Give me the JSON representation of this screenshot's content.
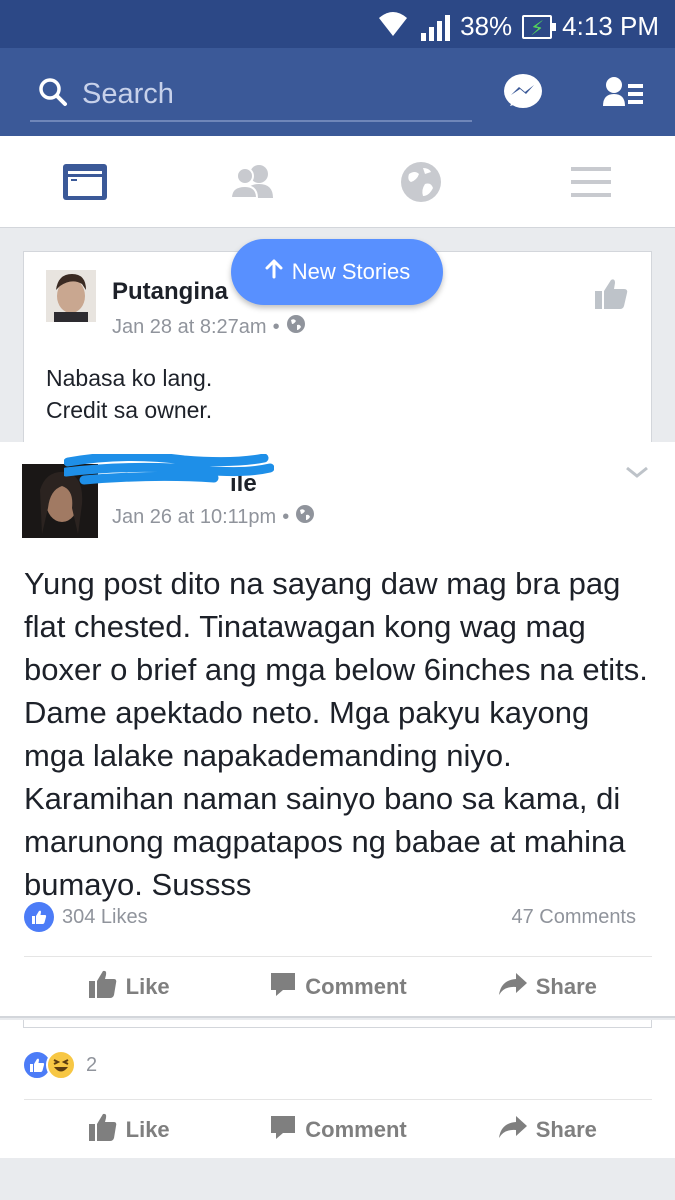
{
  "status_bar": {
    "battery": "38%",
    "time": "4:13 PM"
  },
  "search": {
    "placeholder": "Search"
  },
  "new_stories": {
    "label": "New Stories"
  },
  "post1": {
    "author": "Putangina",
    "timestamp": "Jan 28 at 8:27am",
    "separator": "•",
    "line1": "Nabasa ko lang.",
    "line2": "Credit sa owner."
  },
  "post2": {
    "author_visible": "ile",
    "timestamp": "Jan 26 at 10:11pm",
    "separator": "•",
    "text": "Yung post dito na sayang daw mag bra pag flat chested. Tinatawagan kong wag mag boxer o brief ang mga below 6inches na etits. Dame apektado neto. Mga pakyu kayong mga lalake napakademanding niyo. Karamihan naman sainyo bano sa kama, di marunong magpatapos ng babae at mahina bumayo. Sussss",
    "likes": "304 Likes",
    "comments": "47 Comments"
  },
  "post3": {
    "reaction_count": "2"
  },
  "actions": {
    "like": "Like",
    "comment": "Comment",
    "share": "Share"
  },
  "colors": {
    "brand": "#3b5998",
    "status_bar": "#2c4886",
    "pill": "#5890ff",
    "like_blue": "#4c7cf7"
  }
}
